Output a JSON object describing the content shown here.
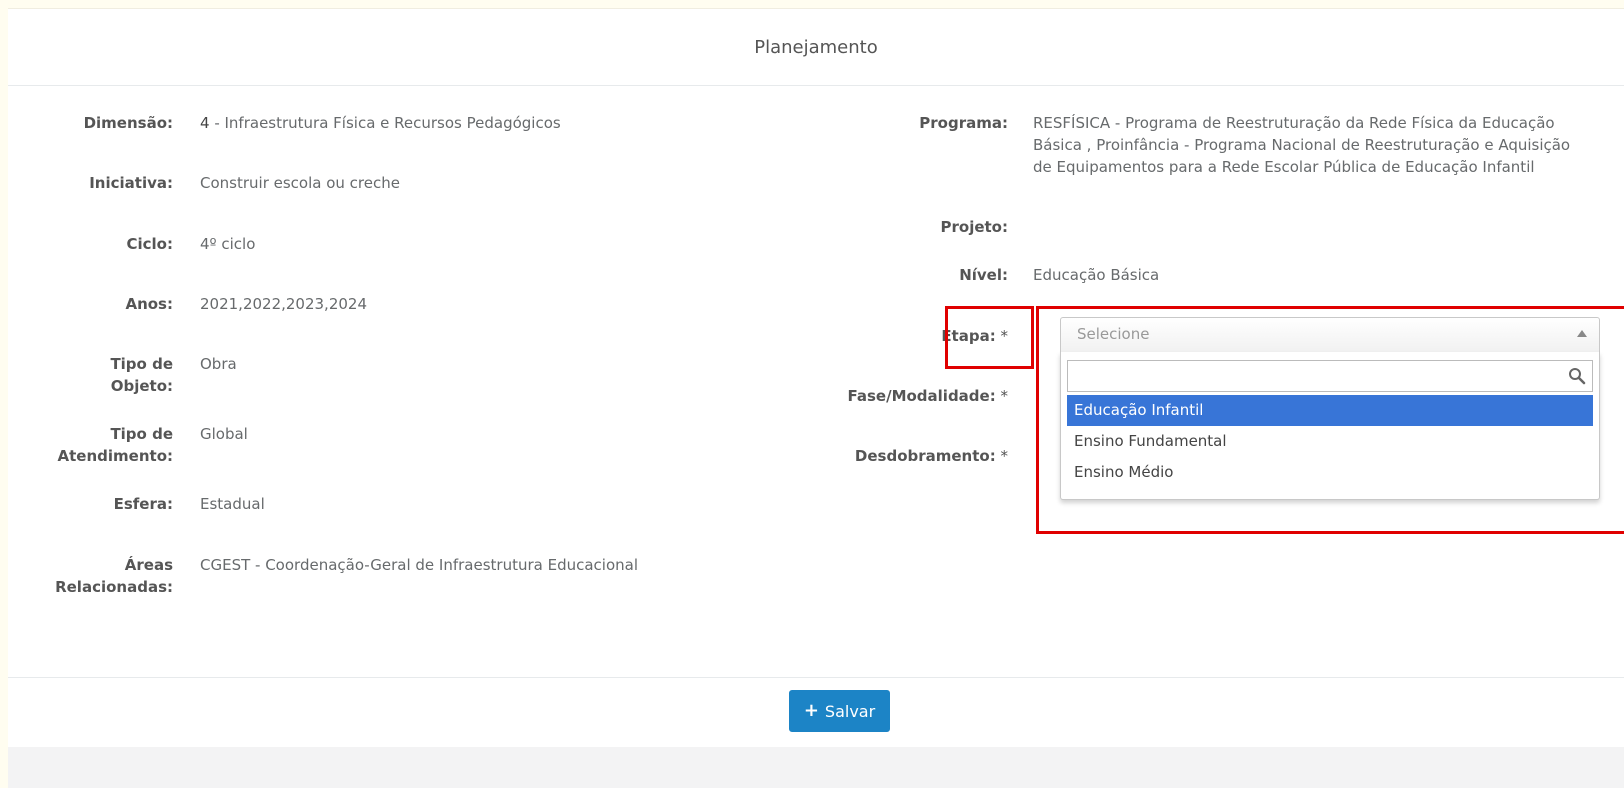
{
  "header": {
    "title": "Planejamento"
  },
  "left_fields": [
    {
      "label": "Dimensão:",
      "value_bold": "4",
      "value": " - Infraestrutura Física e Recursos Pedagógicos"
    },
    {
      "label": "Iniciativa:",
      "value": "Construir escola ou creche"
    },
    {
      "label": "Ciclo:",
      "value": "4º ciclo"
    },
    {
      "label": "Anos:",
      "value": "2021,2022,2023,2024"
    },
    {
      "label_line1": "Tipo de",
      "label_line2": "Objeto:",
      "value": "Obra"
    },
    {
      "label_line1": "Tipo de",
      "label_line2": "Atendimento:",
      "value": "Global"
    },
    {
      "label": "Esfera:",
      "value": "Estadual"
    },
    {
      "label_line1": "Áreas",
      "label_line2": "Relacionadas:",
      "value": "CGEST - Coordenação-Geral de Infraestrutura Educacional"
    }
  ],
  "right_fields": {
    "programa": {
      "label": "Programa:",
      "line1": "RESFÍSICA - Programa de Reestruturação da Rede Física da Educação",
      "line2": "Básica , Proinfância - Programa Nacional de Reestruturação e Aquisição",
      "line3": "de Equipamentos para a Rede Escolar Pública de Educação Infantil"
    },
    "projeto": {
      "label": "Projeto:",
      "value": ""
    },
    "nivel": {
      "label": "Nível:",
      "value": "Educação Básica"
    },
    "etapa": {
      "label": "Etapa:",
      "required": " *"
    },
    "fase": {
      "label": "Fase/Modalidade:",
      "required": " *"
    },
    "desdobramento": {
      "label": "Desdobramento:",
      "required": " *"
    }
  },
  "etapa_select": {
    "placeholder": "Selecione",
    "search_value": "",
    "options": [
      "Educação Infantil",
      "Ensino Fundamental",
      "Ensino Médio"
    ],
    "highlighted_index": 0
  },
  "footer": {
    "save_label": "Salvar"
  },
  "colors": {
    "primary": "#1c84c6",
    "highlight": "#3875d7",
    "annotation": "#e00000"
  }
}
